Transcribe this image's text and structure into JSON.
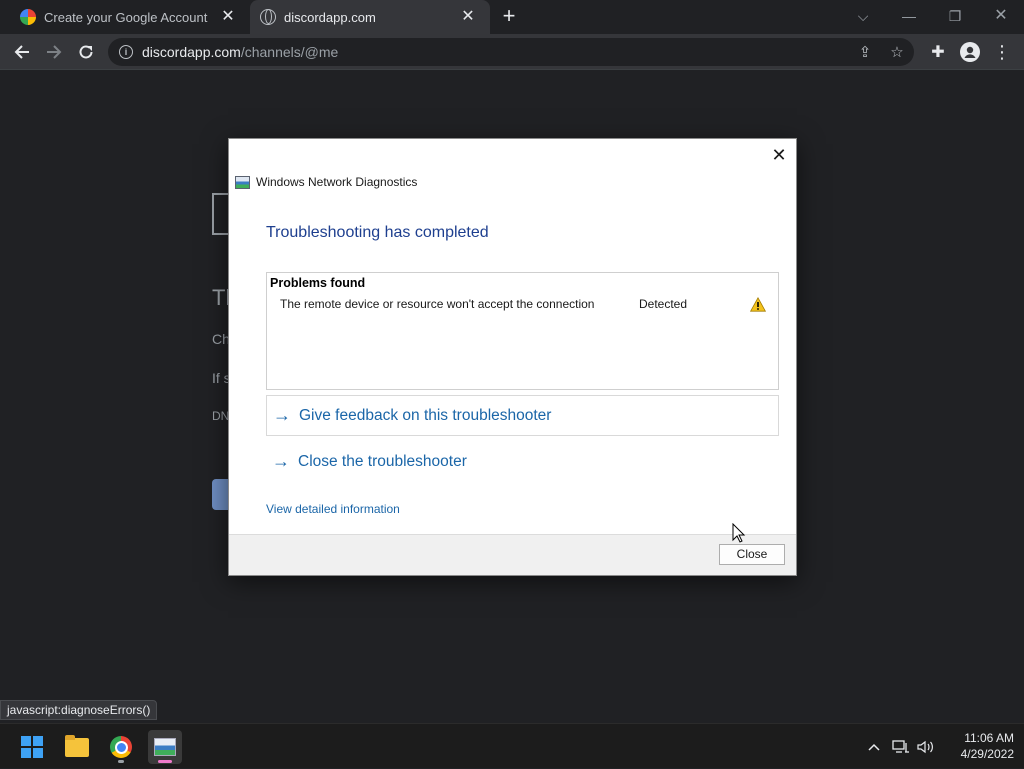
{
  "browser": {
    "tabs": [
      {
        "title": "Create your Google Account",
        "icon": "google-icon"
      },
      {
        "title": "discordapp.com",
        "icon": "globe-icon"
      }
    ],
    "url_domain": "discordapp.com",
    "url_path": "/channels/@me",
    "status_link": "javascript:diagnoseErrors()"
  },
  "page": {
    "title_fragment": "Th",
    "line1_fragment": "Ch",
    "line2_fragment": "If s",
    "line3_fragment": "DN"
  },
  "dialog": {
    "app_name": "Windows Network Diagnostics",
    "heading": "Troubleshooting has completed",
    "problems_title": "Problems found",
    "problem": {
      "description": "The remote device or resource won't accept the connection",
      "status": "Detected",
      "icon": "warning-icon"
    },
    "feedback_link": "Give feedback on this troubleshooter",
    "close_link": "Close the troubleshooter",
    "details_link": "View detailed information",
    "close_button": "Close"
  },
  "taskbar": {
    "apps": [
      "start-icon",
      "file-explorer-icon",
      "chrome-icon",
      "network-diagnostics-icon"
    ],
    "time": "11:06 AM",
    "date": "4/29/2022"
  },
  "colors": {
    "dialog_heading": "#1e3f8f",
    "link": "#1b66a8",
    "accent_start": "#3ea2f5"
  }
}
